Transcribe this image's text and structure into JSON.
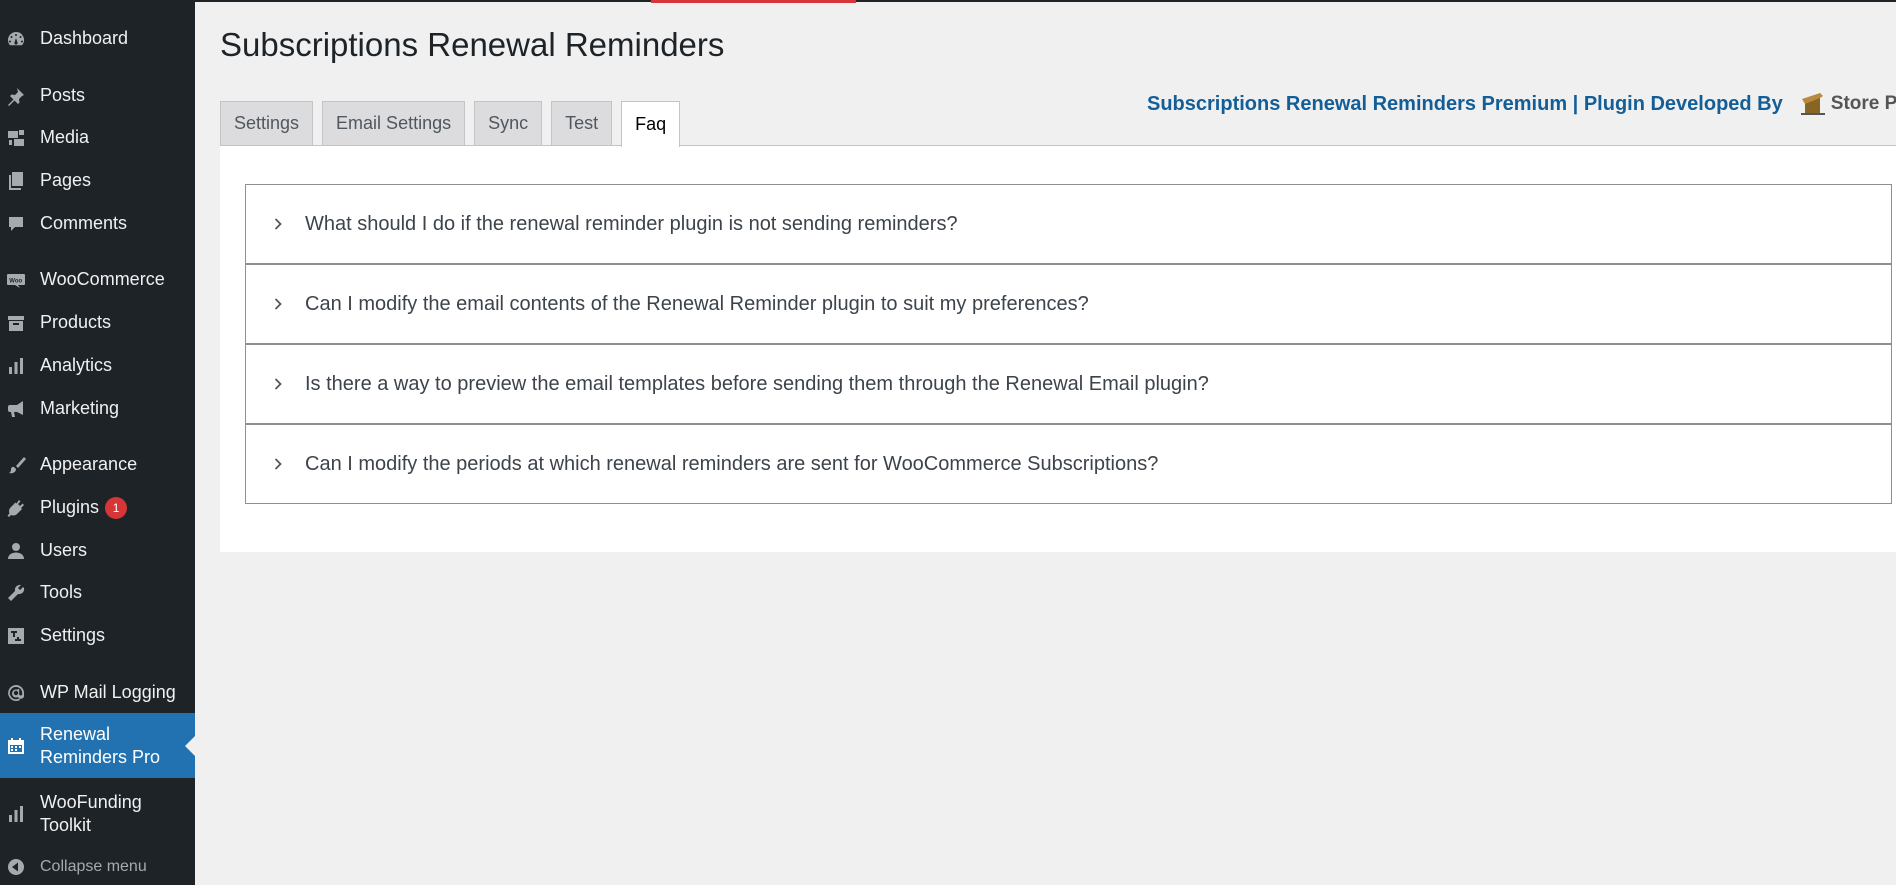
{
  "page": {
    "title": "Subscriptions Renewal Reminders",
    "colors": {
      "sidebar_bg": "#1d2327",
      "active_menu": "#2271b1",
      "link_blue": "#135e96",
      "badge_red": "#d63638"
    }
  },
  "sidebar": {
    "items": [
      {
        "label": "Dashboard",
        "icon": "dashboard-icon"
      },
      {
        "label": "Posts",
        "icon": "pin-icon"
      },
      {
        "label": "Media",
        "icon": "media-icon"
      },
      {
        "label": "Pages",
        "icon": "pages-icon"
      },
      {
        "label": "Comments",
        "icon": "comment-icon"
      },
      {
        "label": "WooCommerce",
        "icon": "woo-icon"
      },
      {
        "label": "Products",
        "icon": "archive-icon"
      },
      {
        "label": "Analytics",
        "icon": "bar-chart-icon"
      },
      {
        "label": "Marketing",
        "icon": "megaphone-icon"
      },
      {
        "label": "Appearance",
        "icon": "paintbrush-icon"
      },
      {
        "label": "Plugins",
        "icon": "plug-icon",
        "badge": "1"
      },
      {
        "label": "Users",
        "icon": "user-icon"
      },
      {
        "label": "Tools",
        "icon": "wrench-icon"
      },
      {
        "label": "Settings",
        "icon": "sliders-icon"
      },
      {
        "label": "WP Mail Logging",
        "icon": "at-icon"
      },
      {
        "label_line1": "Renewal",
        "label_line2": "Reminders Pro",
        "icon": "calendar-icon",
        "current": true
      },
      {
        "label_line1": "WooFunding",
        "label_line2": "Toolkit",
        "icon": "bar-chart-icon"
      }
    ],
    "collapse_label": "Collapse menu"
  },
  "tabs": [
    {
      "label": "Settings",
      "active": false
    },
    {
      "label": "Email Settings",
      "active": false
    },
    {
      "label": "Sync",
      "active": false
    },
    {
      "label": "Test",
      "active": false
    },
    {
      "label": "Faq",
      "active": true
    }
  ],
  "premium": {
    "text": "Subscriptions Renewal Reminders Premium | Plugin Developed By",
    "logo_text": "Store Pro"
  },
  "faq": [
    {
      "question": "What should I do if the renewal reminder plugin is not sending reminders?"
    },
    {
      "question": "Can I modify the email contents of the Renewal Reminder plugin to suit my preferences?"
    },
    {
      "question": "Is there a way to preview the email templates before sending them through the Renewal Email plugin?"
    },
    {
      "question": "Can I modify the periods at which renewal reminders are sent for WooCommerce Subscriptions?"
    }
  ]
}
